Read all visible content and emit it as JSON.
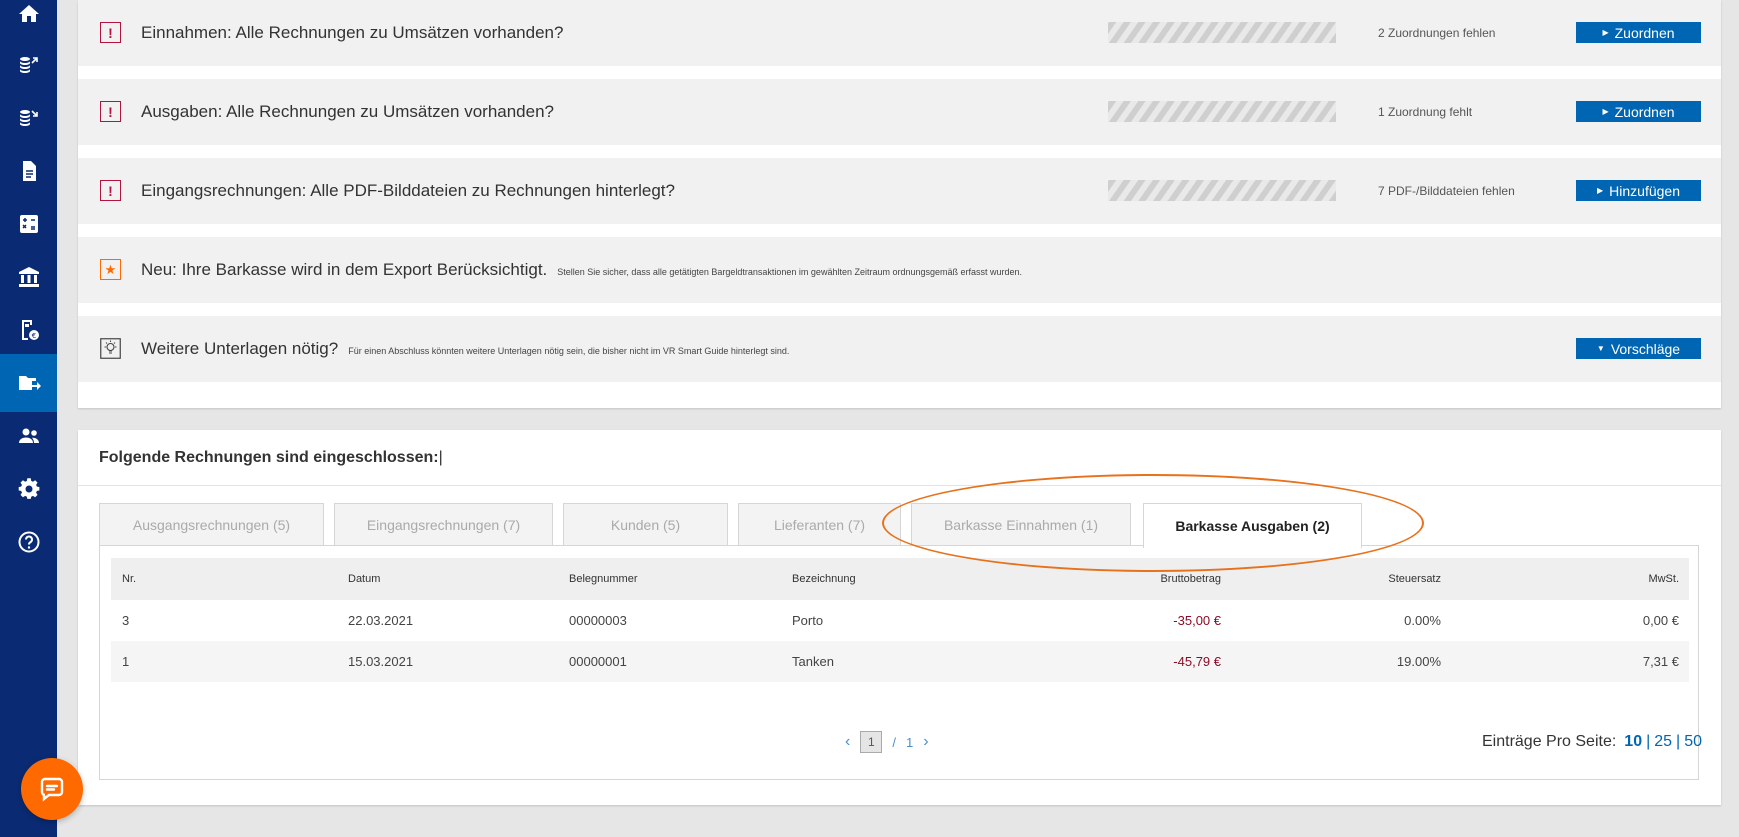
{
  "sidebar": {
    "items": [
      {
        "icon": "home-icon"
      },
      {
        "icon": "income-coins-icon"
      },
      {
        "icon": "expense-coins-icon"
      },
      {
        "icon": "document-icon"
      },
      {
        "icon": "calculator-icon"
      },
      {
        "icon": "bank-icon"
      },
      {
        "icon": "cashbox-icon"
      },
      {
        "icon": "folder-export-icon",
        "active": true
      },
      {
        "icon": "users-icon"
      },
      {
        "icon": "settings-icon"
      },
      {
        "icon": "help-icon"
      }
    ],
    "chat_icon": "chat-bubble-icon"
  },
  "checklist": [
    {
      "type": "warning",
      "title": "Einnahmen: Alle Rechnungen zu Umsätzen vorhanden?",
      "status": "2 Zuordnungen fehlen",
      "button": "Zuordnen"
    },
    {
      "type": "warning",
      "title": "Ausgaben: Alle Rechnungen zu Umsätzen vorhanden?",
      "status": "1 Zuordnung fehlt",
      "button": "Zuordnen"
    },
    {
      "type": "warning",
      "title": "Eingangsrechnungen: Alle PDF-Bilddateien zu Rechnungen hinterlegt?",
      "status": "7 PDF-/Bilddateien fehlen",
      "button": "Hinzufügen"
    },
    {
      "type": "star",
      "title": "Neu: Ihre Barkasse wird in dem Export Berücksichtigt.",
      "note": "Stellen Sie sicher, dass alle getätigten Bargeldtransaktionen im gewählten Zeitraum ordnungsgemäß erfasst wurden."
    },
    {
      "type": "idea",
      "title": "Weitere Unterlagen nötig?",
      "note": "Für einen Abschluss könnten weitere Unterlagen nötig sein, die bisher nicht im VR Smart Guide hinterlegt sind.",
      "button": "Vorschläge"
    }
  ],
  "invoices": {
    "title": "Folgende Rechnungen sind eingeschlossen:",
    "tabs": [
      {
        "label": "Ausgangsrechnungen (5)"
      },
      {
        "label": "Eingangsrechnungen (7)"
      },
      {
        "label": "Kunden (5)"
      },
      {
        "label": "Lieferanten (7)"
      },
      {
        "label": "Barkasse Einnahmen (1)"
      },
      {
        "label": "Barkasse Ausgaben (2)",
        "active": true
      }
    ],
    "columns": [
      "Nr.",
      "Datum",
      "Belegnummer",
      "Bezeichnung",
      "Bruttobetrag",
      "Steuersatz",
      "MwSt."
    ],
    "rows": [
      {
        "nr": "3",
        "datum": "22.03.2021",
        "beleg": "00000003",
        "bez": "Porto",
        "brutto": "-35,00 €",
        "steuer": "0.00%",
        "mwst": "0,00 €"
      },
      {
        "nr": "1",
        "datum": "15.03.2021",
        "beleg": "00000001",
        "bez": "Tanken",
        "brutto": "-45,79 €",
        "steuer": "19.00%",
        "mwst": "7,31 €"
      }
    ],
    "pagination": {
      "current": "1",
      "separator": "/",
      "total": "1"
    },
    "per_page": {
      "label": "Einträge Pro Seite:",
      "options": [
        "10",
        "25",
        "50"
      ],
      "selected": "10"
    }
  },
  "colors": {
    "sidebar": "#0a2b73",
    "sidebar_active": "#0066b3",
    "primary_button": "#0066b3",
    "warning": "#b3143d",
    "accent": "#ff6a00",
    "negative_amount": "#8b0b26",
    "highlight_ring": "#e8711c"
  }
}
